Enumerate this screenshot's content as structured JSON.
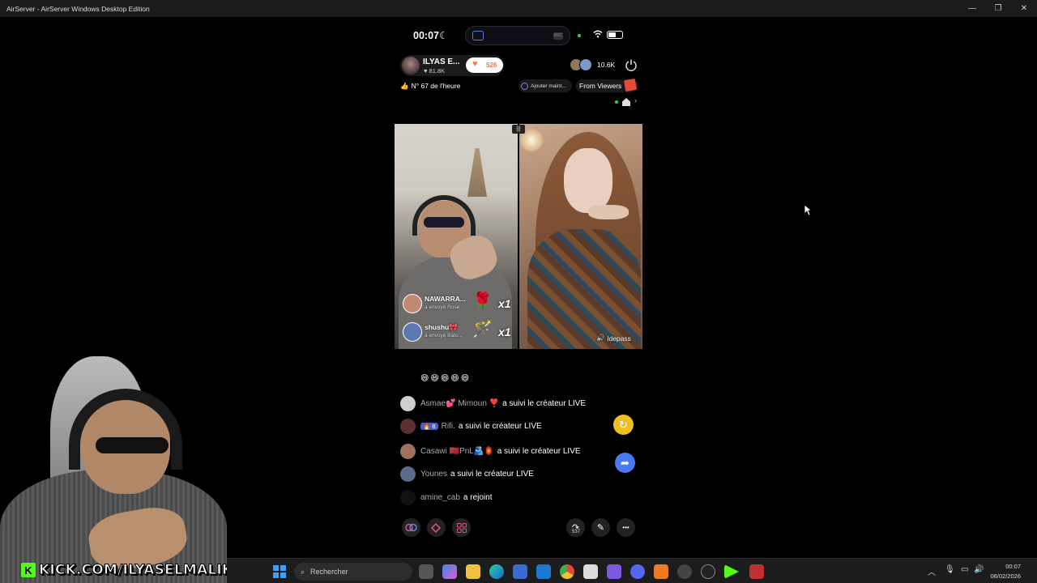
{
  "window": {
    "title": "AirServer - AirServer Windows Desktop Edition",
    "minimize": "—",
    "maximize": "❐",
    "close": "✕"
  },
  "status_bar": {
    "time": "00:07",
    "moon": "☾"
  },
  "live": {
    "host_name": "ILYAS E...",
    "host_likes": "♥ 81.8K",
    "follow_count": "526",
    "viewer_count": "10.6K",
    "rank": "N° 67 de l'heure",
    "rank_icon": "👍",
    "add_button": "Ajouter maint...",
    "from_viewers": "From Viewers"
  },
  "video": {
    "divider_icon": "|||",
    "gifts": [
      {
        "user": "NAWARRA...",
        "sub": "a envoyé  Rose",
        "gift_icon": "🌹",
        "multiplier": "x1"
      },
      {
        "user": "shushu🎀",
        "sub": "a envoyé  Bâto...",
        "gift_icon": "🪄",
        "multiplier": "x1"
      }
    ],
    "speaker_label": "ldepass",
    "speaker_icon": "🔊"
  },
  "chat": {
    "emoji_line": "😄😄😄😄😄",
    "messages": [
      {
        "user": "Asmae💕 Mimoun ❣️",
        "badge": "",
        "text": "a suivi le créateur LIVE",
        "avatar_color": "#cfcfcf"
      },
      {
        "user": "Rifi.",
        "badge": "🔥 8",
        "text": "a suivi le créateur LIVE",
        "avatar_color": "#5a3030"
      },
      {
        "user": "Casawi 🇲🇦PnL🫂🏮",
        "badge": "",
        "text": "a suivi le créateur LIVE",
        "avatar_color": "#a07060"
      },
      {
        "user": "Younes",
        "badge": "",
        "text": "a suivi le créateur LIVE",
        "avatar_color": "#5a6a8a"
      },
      {
        "user": "amine_cab",
        "badge": "",
        "text": "a rejoint",
        "avatar_color": "#111111"
      }
    ]
  },
  "side_buttons": {
    "refresh_icon": "↻",
    "share_icon": "➦"
  },
  "toolbar": {
    "share_count": "537",
    "more_icon": "•••"
  },
  "streamer": {
    "kick_logo": "K",
    "kick_text": "KICK.COM/ILYASELMALIKI"
  },
  "taskbar": {
    "search_placeholder": "Rechercher",
    "time": "00:07",
    "date": "06/02/2026",
    "tray_chevron": "︿",
    "mic_icon": "🎙",
    "volume_icon": "🔊"
  },
  "colors": {
    "accent_orange": "#ff6a3d",
    "kick_green": "#53fc18",
    "windows_blue": "#3aa0ff",
    "refresh_yellow": "#f0c020",
    "share_blue": "#4a7af0"
  }
}
